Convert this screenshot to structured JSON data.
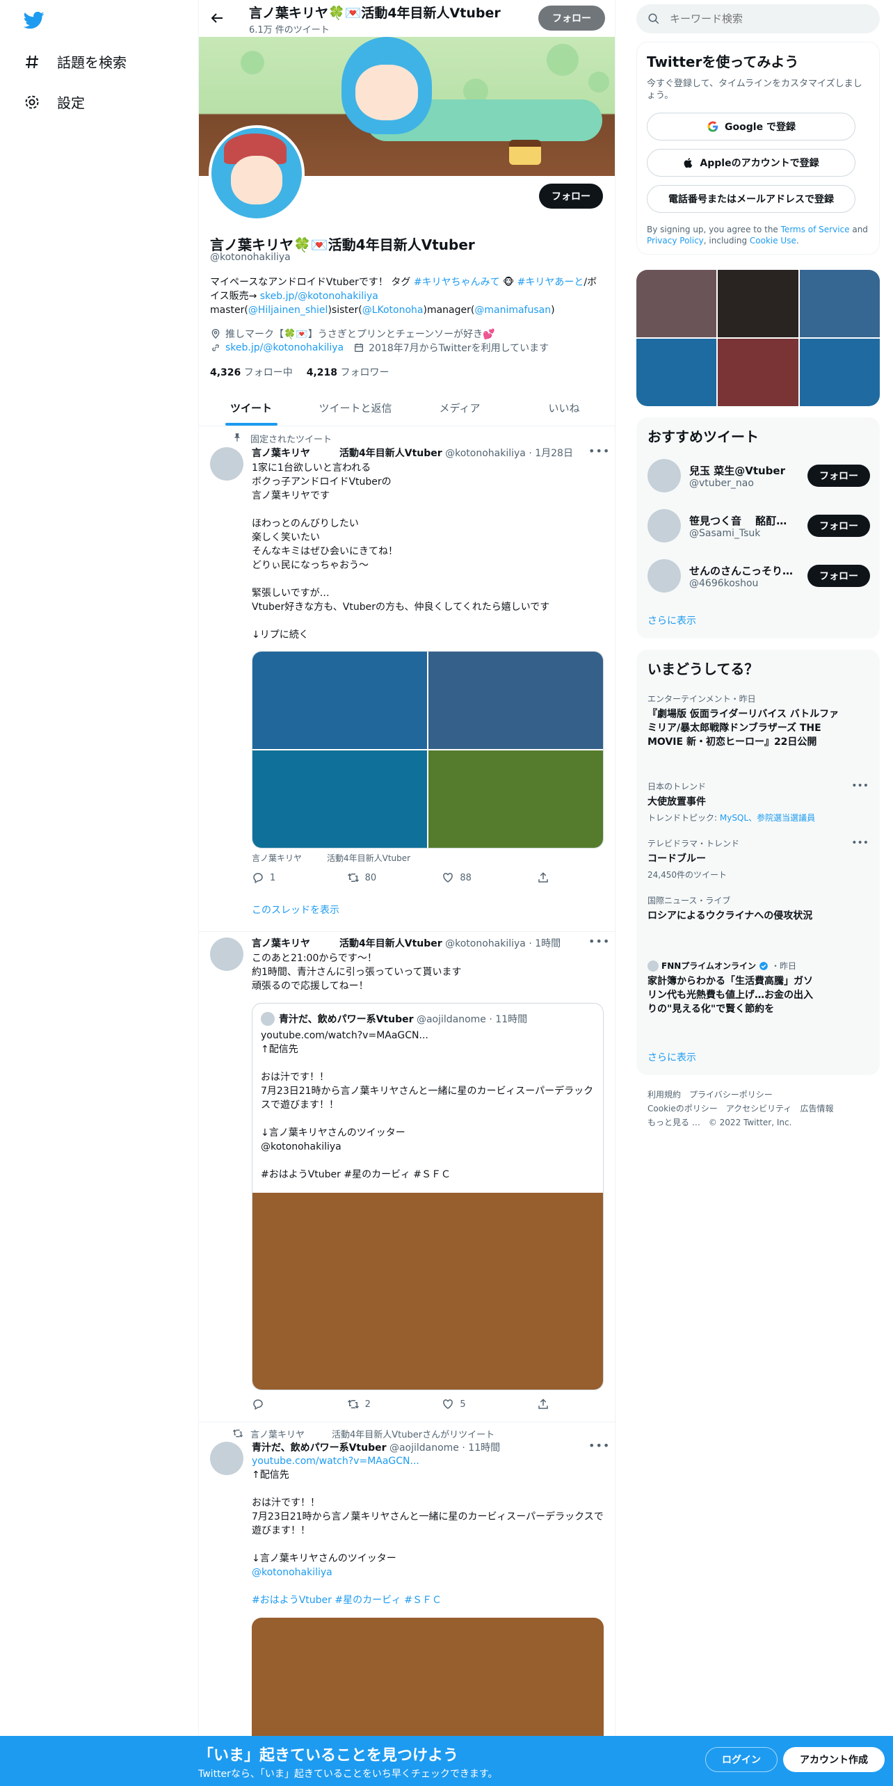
{
  "nav": {
    "explore": "話題を検索",
    "settings": "設定"
  },
  "header": {
    "title": "言ノ葉キリヤ🍀💌活動4年目新人Vtuber",
    "tweet_count": "6.1万 件のツイート",
    "follow": "フォロー"
  },
  "profile": {
    "name": "言ノ葉キリヤ🍀💌活動4年目新人Vtuber",
    "handle": "@kotonohakiliya",
    "follow": "フォロー",
    "bio_1": "マイペースなアンドロイドVtuberです！ タグ ",
    "bio_tag1": "#キリヤちゃんみて",
    "bio_tag2": "#キリヤあーと",
    "bio_2": "/ボイス販売→ ",
    "bio_link": "skeb.jp/@kotonohakiliya",
    "bio_3": " master(",
    "bio_master": "@Hiljainen_shiel",
    "bio_4": ")sister(",
    "bio_sister": "@LKotonoha",
    "bio_5": ")manager(",
    "bio_manager": "@manimafusan",
    "bio_6": ")",
    "location": "推しマーク【🍀💌】うさぎとプリンとチェーンソーが好き💕",
    "url": "skeb.jp/@kotonohakiliya",
    "joined": "2018年7月からTwitterを利用しています",
    "following_count": "4,326",
    "following_label": "フォロー中",
    "followers_count": "4,218",
    "followers_label": "フォロワー"
  },
  "tabs": [
    "ツイート",
    "ツイートと返信",
    "メディア",
    "いいね"
  ],
  "tweets": [
    {
      "context": "固定されたツイート",
      "name": "言ノ葉キリヤ　　　活動4年目新人Vtuber",
      "handle": "@kotonohakiliya",
      "time": "1月28日",
      "text": "1家に1台欲しいと言われる\nボクっ子アンドロイドVtuberの\n言ノ葉キリヤです\n\nほわっとのんびりしたい\n楽しく笑いたい\nそんなキミはぜひ会いにきてね！\nどりぃ民になっちゃおう～\n\n緊張しいですが…\nVtuber好きな方も、Vtuberの方も、仲良くしてくれたら嬉しいです\n\n↓リプに続く",
      "media_colors": [
        "#21679b",
        "#356089",
        "#0f7199",
        "#557c2d"
      ],
      "caption": "言ノ葉キリヤ　　　活動4年目新人Vtuber",
      "replies": "1",
      "retweets": "80",
      "likes": "88",
      "thread": "このスレッドを表示"
    },
    {
      "name": "言ノ葉キリヤ　　　活動4年目新人Vtuber",
      "handle": "@kotonohakiliya",
      "time": "1時間",
      "text": "このあと21:00からです～！\n約1時間、青汁さんに引っ張っていって貰います\n頑張るので応援してねー！",
      "quote": {
        "name": "青汁だ、飲めパワー系Vtuber",
        "handle": "@aojildanome",
        "time": "11時間",
        "text": "youtube.com/watch?v=MAaGCN...\n↑配信先\n\nおは汁です！！\n7月23日21時から言ノ葉キリヤさんと一緒に星のカービィスーパーデラックスで遊びます！！\n\n↓言ノ葉キリヤさんのツイッター\n@kotonohakiliya\n\n#おはようVtuber #星のカービィ #ＳＦＣ",
        "media_color": "#975e2e"
      },
      "replies": "",
      "retweets": "2",
      "likes": "5"
    },
    {
      "context": "言ノ葉キリヤ　　　活動4年目新人Vtuberさんがリツイート",
      "name": "青汁だ、飲めパワー系Vtuber",
      "handle": "@aojildanome",
      "time": "11時間",
      "link": "youtube.com/watch?v=MAaGCN...",
      "text": "↑配信先\n\nおは汁です！！\n7月23日21時から言ノ葉キリヤさんと一緒に星のカービィスーパーデラックスで遊びます！！\n\n↓言ノ葉キリヤさんのツイッター",
      "mention": "@kotonohakiliya",
      "tags": "#おはようVtuber #星のカービィ #ＳＦＣ",
      "media_color": "#975e2e"
    }
  ],
  "sidebar": {
    "search_placeholder": "キーワード検索",
    "signup_title": "Twitterを使ってみよう",
    "signup_desc": "今すぐ登録して、タイムラインをカスタマイズしましょう。",
    "google": "Google で登録",
    "apple": "Appleのアカウントで登録",
    "phone": "電話番号またはメールアドレスで登録",
    "terms_1": "By signing up, you agree to the ",
    "terms_tos": "Terms of Service",
    "terms_2": " and ",
    "terms_privacy": "Privacy Policy",
    "terms_3": ", including ",
    "terms_cookie": "Cookie Use",
    "terms_4": ".",
    "gallery_colors": [
      "#6b5458",
      "#292322",
      "#366692",
      "#1d6ba1",
      "#7a3436",
      "#1f6ba1"
    ],
    "recs_title": "おすすめツイート",
    "recs": [
      {
        "name": "兒玉 菜生@Vtuber",
        "handle": "@vtuber_nao",
        "follow": "フォロー"
      },
      {
        "name": "笹見つく音　 酩酊O…",
        "handle": "@Sasami_Tsuk",
        "follow": "フォロー"
      },
      {
        "name": "せんのさんこっそり…",
        "handle": "@4696koshou",
        "follow": "フォロー"
      }
    ],
    "recs_more": "さらに表示",
    "trends_title": "いまどうしてる？",
    "trends": [
      {
        "ctx": "エンターテインメント・昨日",
        "title": "『劇場版 仮面ライダーリバイス バトルファミリア/暴太郎戦隊ドンブラザーズ THE MOVIE 新・初恋ヒーロー』22日公開"
      },
      {
        "ctx": "日本のトレンド",
        "title": "大使放置事件",
        "sub_label": "トレンドトピック: ",
        "sub_links": "MySQL、参院選当選議員"
      },
      {
        "ctx": "テレビドラマ・トレンド",
        "title": "コードブルー",
        "sub": "24,450件のツイート"
      },
      {
        "ctx": "国際ニュース・ライブ",
        "title": "ロシアによるウクライナへの侵攻状況"
      },
      {
        "ctx_name": "FNNプライムオンライン",
        "ctx_time": "・昨日",
        "title": "家計簿からわかる「生活費高騰」ガソリン代も光熱費も値上げ…お金の出入りの\"見える化\"で賢く節約を"
      }
    ],
    "trends_more": "さらに表示",
    "footer": [
      "利用規約",
      "プライバシーポリシー",
      "Cookieのポリシー",
      "アクセシビリティ",
      "広告情報",
      "もっと見る …",
      "© 2022 Twitter, Inc."
    ]
  },
  "bottom": {
    "title": "「いま」起きていることを見つけよう",
    "sub": "Twitterなら、「いま」起きていることをいち早くチェックできます。",
    "login": "ログイン",
    "signup": "アカウント作成"
  },
  "colors": {
    "accent": "#1d9bf0",
    "dark": "#0f1419",
    "muted": "#536471"
  }
}
